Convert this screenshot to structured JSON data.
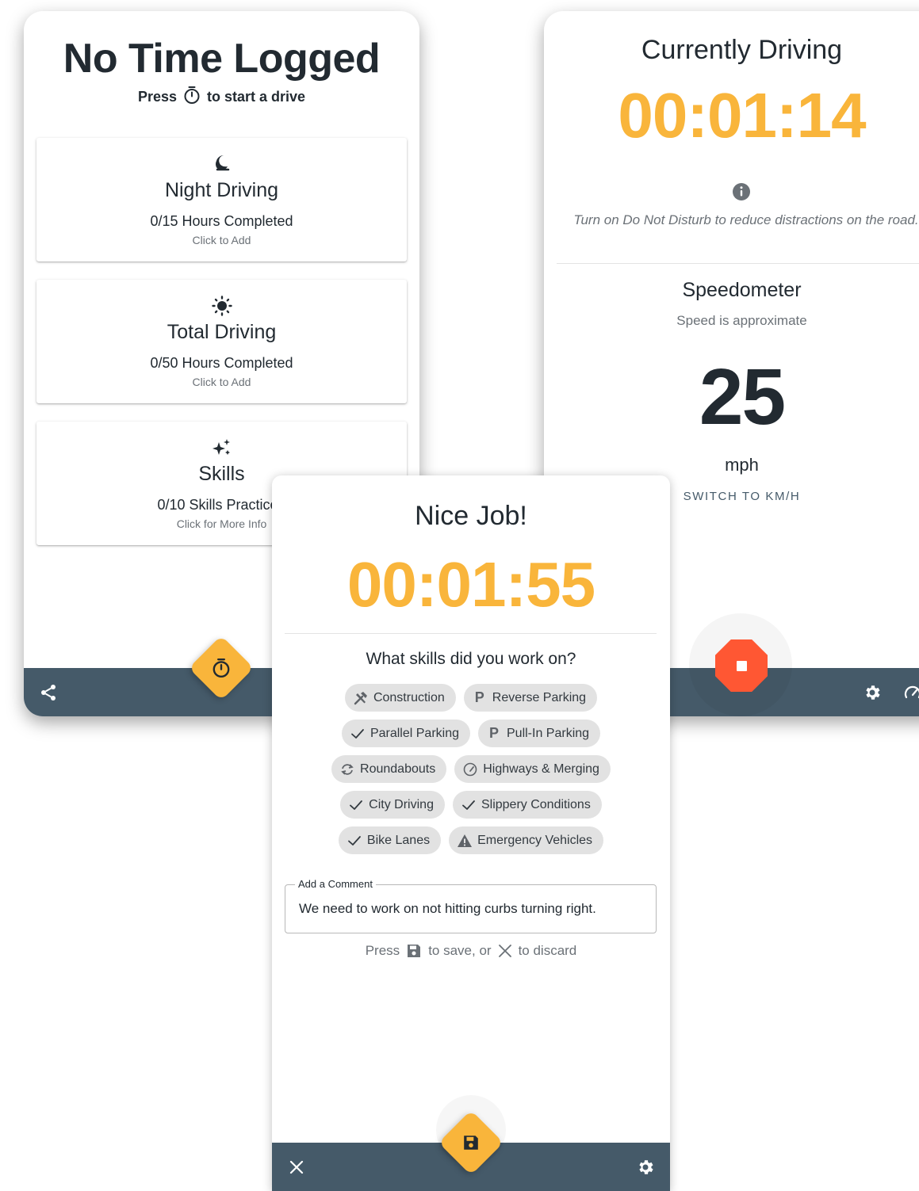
{
  "home": {
    "title": "No Time Logged",
    "subtitle_before": "Press",
    "subtitle_after": "to start a drive",
    "cards": [
      {
        "icon": "moon-icon",
        "title": "Night Driving",
        "progress": "0/15 Hours Completed",
        "action": "Click to Add"
      },
      {
        "icon": "sun-icon",
        "title": "Total Driving",
        "progress": "0/50 Hours Completed",
        "action": "Click to Add"
      },
      {
        "icon": "sparkle-icon",
        "title": "Skills",
        "progress": "0/10 Skills Practiced",
        "action": "Click for More Info"
      }
    ],
    "fab_icon": "stopwatch-icon",
    "bar_left_icon": "share-icon"
  },
  "drive": {
    "title": "Currently Driving",
    "timer": "00:01:14",
    "info_icon": "info-icon",
    "tip": "Turn on Do Not Disturb to reduce distractions on the road.",
    "speedometer_title": "Speedometer",
    "speedometer_subtitle": "Speed is approximate",
    "speed": "25",
    "unit": "mph",
    "switch_label": "SWITCH TO KM/H",
    "stop_icon": "stop-icon",
    "bar_icons": [
      "gear-icon",
      "speedometer-icon"
    ]
  },
  "finish": {
    "title": "Nice Job!",
    "timer": "00:01:55",
    "question": "What skills did you work on?",
    "chip_rows": [
      [
        {
          "icon": "tools-icon",
          "label": "Construction"
        },
        {
          "icon": "parking-icon",
          "label": "Reverse Parking"
        }
      ],
      [
        {
          "icon": "check-icon",
          "label": "Parallel Parking"
        },
        {
          "icon": "parking-icon",
          "label": "Pull-In Parking"
        }
      ],
      [
        {
          "icon": "roundabout-icon",
          "label": "Roundabouts"
        },
        {
          "icon": "speedometer-icon",
          "label": "Highways & Merging"
        }
      ],
      [
        {
          "icon": "check-icon",
          "label": "City Driving"
        },
        {
          "icon": "check-icon",
          "label": "Slippery Conditions"
        }
      ],
      [
        {
          "icon": "check-icon",
          "label": "Bike Lanes"
        },
        {
          "icon": "warning-icon",
          "label": "Emergency Vehicles"
        }
      ]
    ],
    "comment_label": "Add a Comment",
    "comment_value": "We need to work on not hitting curbs turning right.",
    "hint_press": "Press",
    "hint_save": "to save, or",
    "hint_discard": "to discard",
    "fab_icon": "save-icon",
    "bar_icons": [
      "close-icon",
      "gear-icon"
    ]
  },
  "colors": {
    "accent": "#f9b53b",
    "stop": "#ff5733",
    "bar": "#455a69",
    "text": "#222a31",
    "muted": "#6b7177",
    "chip": "#e2e2e2"
  }
}
